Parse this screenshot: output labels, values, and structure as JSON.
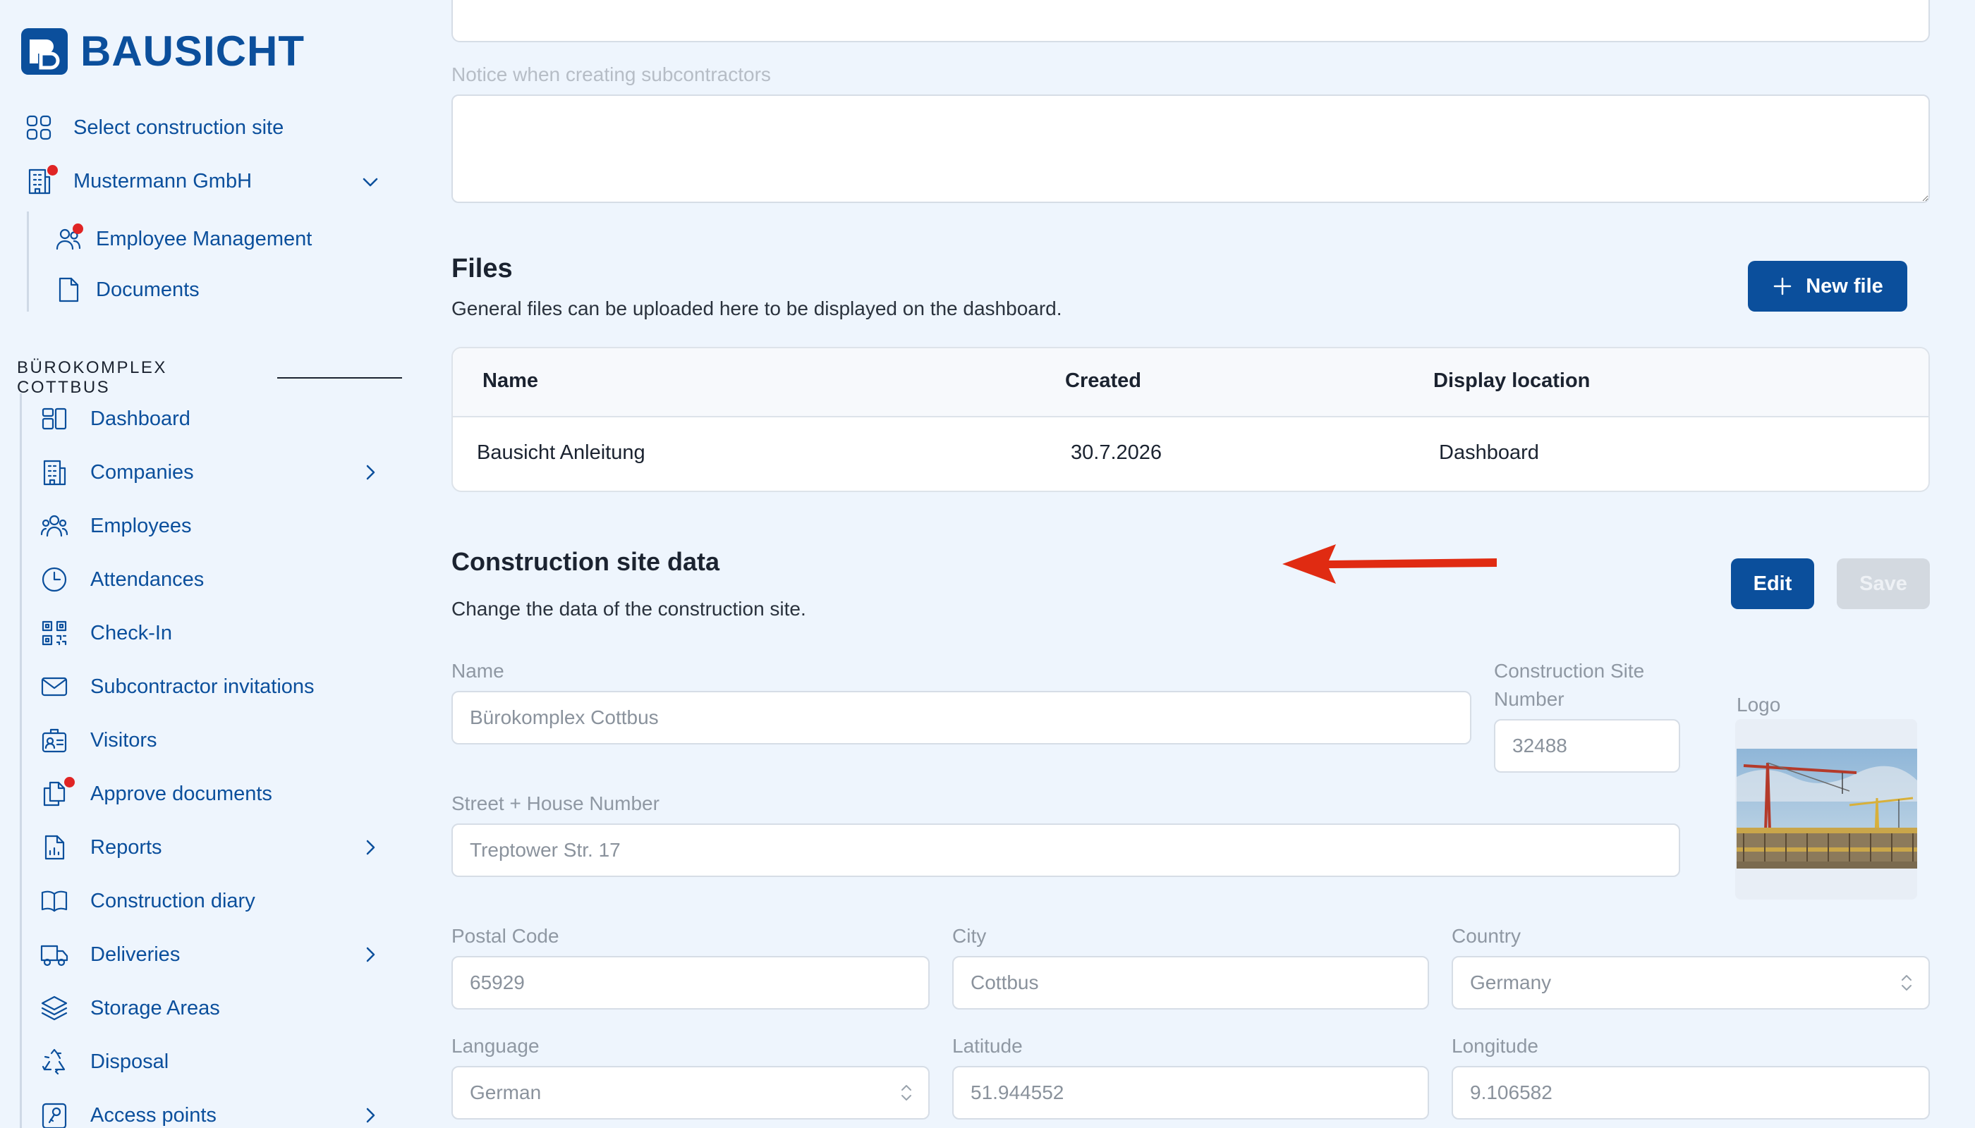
{
  "brand": {
    "name": "BAUSICHT",
    "accent": "#0b4f9c",
    "alert": "#e02424"
  },
  "sidebar": {
    "select_site": "Select construction site",
    "company": "Mustermann GmbH",
    "company_items": [
      {
        "label": "Employee Management",
        "icon": "users-icon",
        "alert": true
      },
      {
        "label": "Documents",
        "icon": "document-icon",
        "alert": false
      }
    ],
    "section": "BÜROKOMPLEX COTTBUS",
    "items": [
      {
        "label": "Dashboard",
        "icon": "dashboard-icon"
      },
      {
        "label": "Companies",
        "icon": "building-icon",
        "expandable": true
      },
      {
        "label": "Employees",
        "icon": "users-icon"
      },
      {
        "label": "Attendances",
        "icon": "clock-icon"
      },
      {
        "label": "Check-In",
        "icon": "qr-icon"
      },
      {
        "label": "Subcontractor invitations",
        "icon": "mail-icon"
      },
      {
        "label": "Visitors",
        "icon": "visitor-badge-icon"
      },
      {
        "label": "Approve documents",
        "icon": "documents-icon",
        "alert": true
      },
      {
        "label": "Reports",
        "icon": "report-icon",
        "expandable": true
      },
      {
        "label": "Construction diary",
        "icon": "book-icon"
      },
      {
        "label": "Deliveries",
        "icon": "truck-icon",
        "expandable": true
      },
      {
        "label": "Storage Areas",
        "icon": "layers-icon"
      },
      {
        "label": "Disposal",
        "icon": "recycle-icon"
      },
      {
        "label": "Access points",
        "icon": "access-point-icon",
        "expandable": true
      }
    ]
  },
  "main": {
    "notice_label": "Notice when creating subcontractors",
    "files": {
      "title": "Files",
      "subtitle": "General files can be uploaded here to be displayed on the dashboard.",
      "new_file": "New file",
      "columns": [
        "Name",
        "Created",
        "Display location"
      ],
      "rows": [
        {
          "name": "Bausicht Anleitung",
          "created": "30.7.2026",
          "location": "Dashboard"
        }
      ]
    },
    "site": {
      "title": "Construction site data",
      "subtitle": "Change the data of the construction site.",
      "edit": "Edit",
      "save": "Save",
      "name_label": "Name",
      "name_value": "Bürokomplex Cottbus",
      "number_label": "Construction Site Number",
      "number_value": "32488",
      "logo_label": "Logo",
      "street_label": "Street + House Number",
      "street_value": "Treptower Str. 17",
      "postal_label": "Postal Code",
      "postal_value": "65929",
      "city_label": "City",
      "city_value": "Cottbus",
      "country_label": "Country",
      "country_value": "Germany",
      "language_label": "Language",
      "language_value": "German",
      "lat_label": "Latitude",
      "lat_value": "51.944552",
      "lng_label": "Longitude",
      "lng_value": "9.106582"
    }
  }
}
